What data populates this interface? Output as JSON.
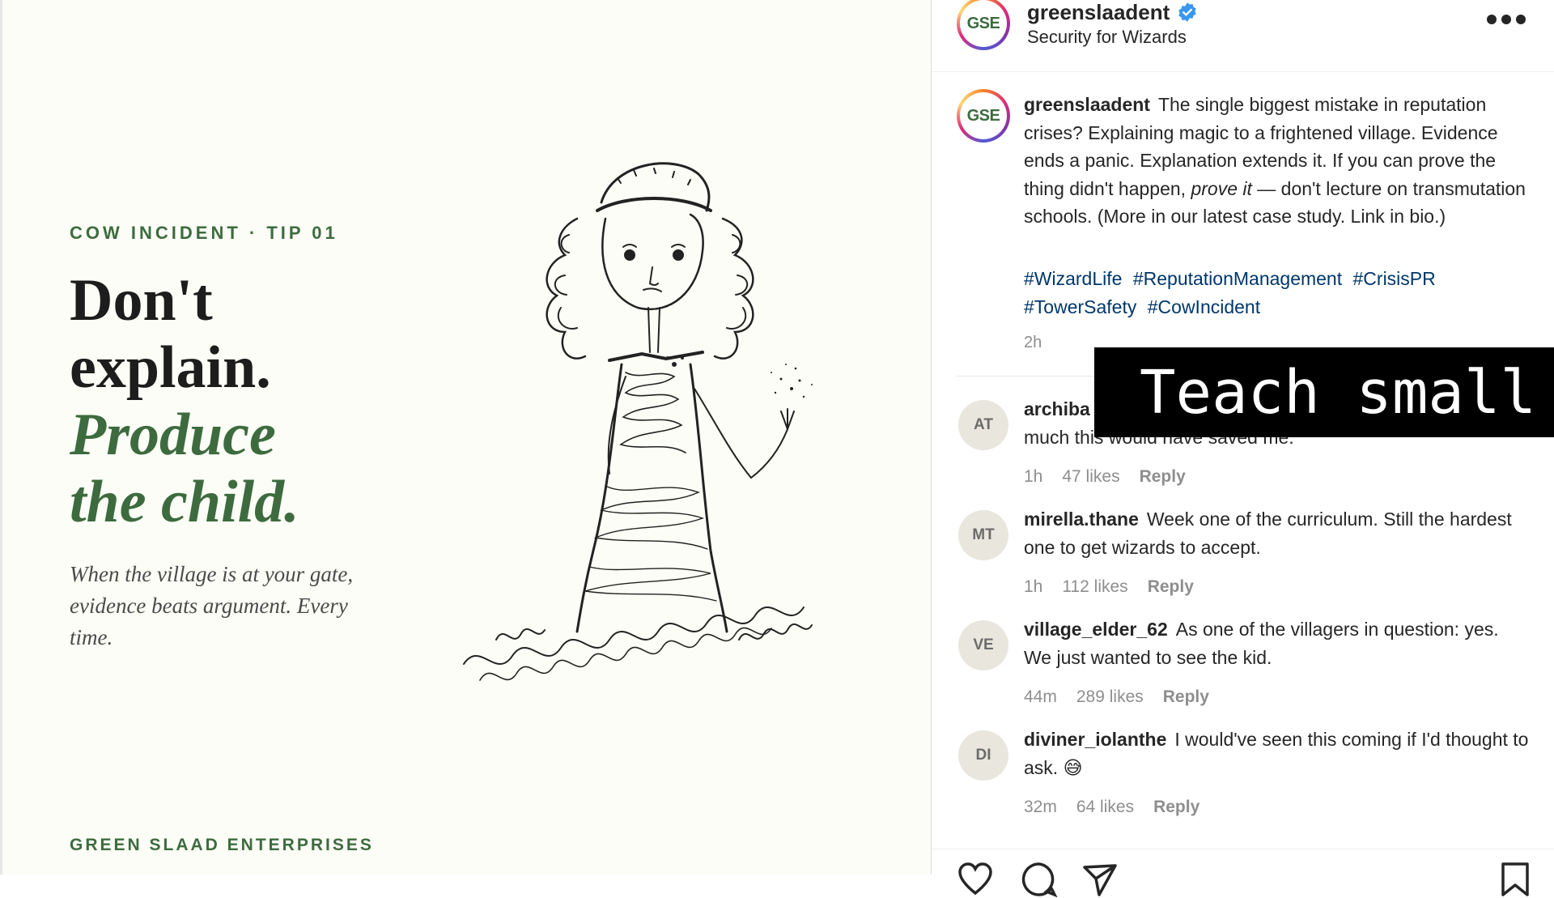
{
  "post_image": {
    "eyebrow": "COW INCIDENT · TIP 01",
    "headline_line1": "Don't",
    "headline_line2": "explain.",
    "headline_line3": "Produce",
    "headline_line4": "the child.",
    "subtext": "When the village is at your gate, evidence beats argument. Every time.",
    "brand": "GREEN SLAAD ENTERPRISES",
    "accent_color": "#3d6b3f"
  },
  "header": {
    "avatar_text": "GSE",
    "username": "greenslaadent",
    "verified_icon": "verified-badge-icon",
    "subtitle": "Security for Wizards",
    "more_icon": "more-options-icon"
  },
  "caption": {
    "avatar_text": "GSE",
    "username": "greenslaadent",
    "text_part1": "The single biggest mistake in reputation crises? Explaining magic to a frightened village. Evidence ends a panic. Explanation extends it. If you can prove the thing didn't happen, ",
    "text_em": "prove it",
    "text_part2": " — don't lecture on transmutation schools. (More in our latest case study. Link in bio.)",
    "hashtags": [
      "#WizardLife",
      "#ReputationManagement",
      "#CrisisPR",
      "#TowerSafety",
      "#CowIncident"
    ],
    "time": "2h"
  },
  "comments": [
    {
      "initials": "AT",
      "username": "archiba",
      "text": "much this would have saved me.",
      "time": "1h",
      "likes": "47 likes",
      "reply": "Reply"
    },
    {
      "initials": "MT",
      "username": "mirella.thane",
      "text": "Week one of the curriculum. Still the hardest one to get wizards to accept.",
      "time": "1h",
      "likes": "112 likes",
      "reply": "Reply"
    },
    {
      "initials": "VE",
      "username": "village_elder_62",
      "text": "As one of the villagers in question: yes. We just wanted to see the kid.",
      "time": "44m",
      "likes": "289 likes",
      "reply": "Reply"
    },
    {
      "initials": "DI",
      "username": "diviner_iolanthe",
      "text": "I would've seen this coming if I'd thought to ask. 😅",
      "time": "32m",
      "likes": "64 likes",
      "reply": "Reply"
    }
  ],
  "actions": {
    "like_icon": "heart-icon",
    "comment_icon": "comment-icon",
    "share_icon": "share-icon",
    "save_icon": "bookmark-icon"
  },
  "overlay": {
    "text": "Teach small"
  }
}
